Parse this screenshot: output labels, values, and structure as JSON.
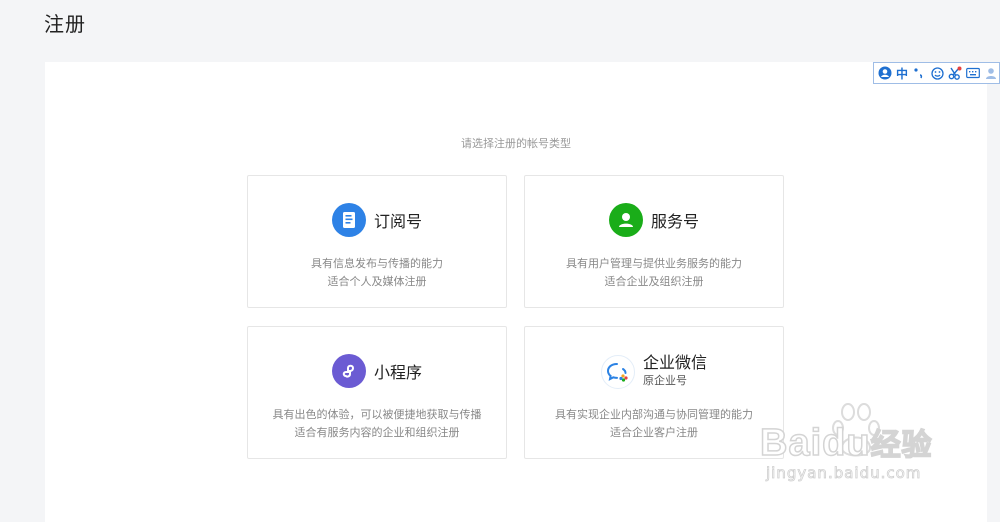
{
  "page": {
    "title": "注册"
  },
  "subtitle": "请选择注册的帐号类型",
  "ime_toolbar": {
    "lang": "中"
  },
  "cards": [
    {
      "name": "订阅号",
      "sub": "",
      "desc1": "具有信息发布与传播的能力",
      "desc2": "适合个人及媒体注册",
      "icon": "document-icon",
      "color": "#2e82e6"
    },
    {
      "name": "服务号",
      "sub": "",
      "desc1": "具有用户管理与提供业务服务的能力",
      "desc2": "适合企业及组织注册",
      "icon": "user-icon",
      "color": "#1aad19"
    },
    {
      "name": "小程序",
      "sub": "",
      "desc1": "具有出色的体验，可以被便捷地获取与传播",
      "desc2": "适合有服务内容的企业和组织注册",
      "icon": "mini-program-icon",
      "color": "#6467f0"
    },
    {
      "name": "企业微信",
      "sub": "原企业号",
      "desc1": "具有实现企业内部沟通与协同管理的能力",
      "desc2": "适合企业客户注册",
      "icon": "work-wechat-icon",
      "color": "#2b82e4"
    }
  ],
  "watermark": {
    "brand": "Baidu",
    "tag": "经验",
    "url": "jingyan.baidu.com"
  }
}
